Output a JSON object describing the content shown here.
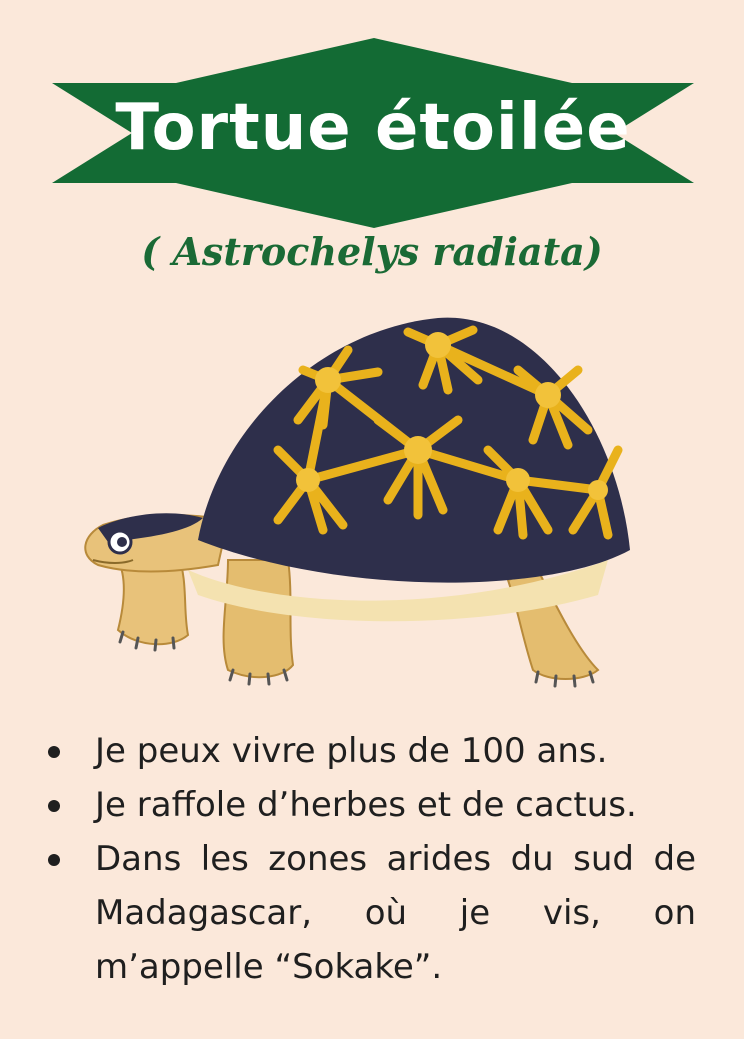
{
  "title": "Tortue étoilée",
  "scientific_name": "( Astrochelys radiata)",
  "illustration": {
    "subject": "tortoise-illustration"
  },
  "facts": [
    "Je peux vivre plus de 100 ans.",
    "Je raffole d’herbes et de cactus.",
    "Dans les zones arides du sud de Madagascar, où je vis, on m’appelle “Sokake”."
  ],
  "colors": {
    "background": "#fbe8da",
    "banner": "#136b34",
    "accent_text": "#1a6a35",
    "shell_dark": "#2e2f4b",
    "shell_gold": "#e9b21c",
    "skin": "#e8c27a"
  }
}
